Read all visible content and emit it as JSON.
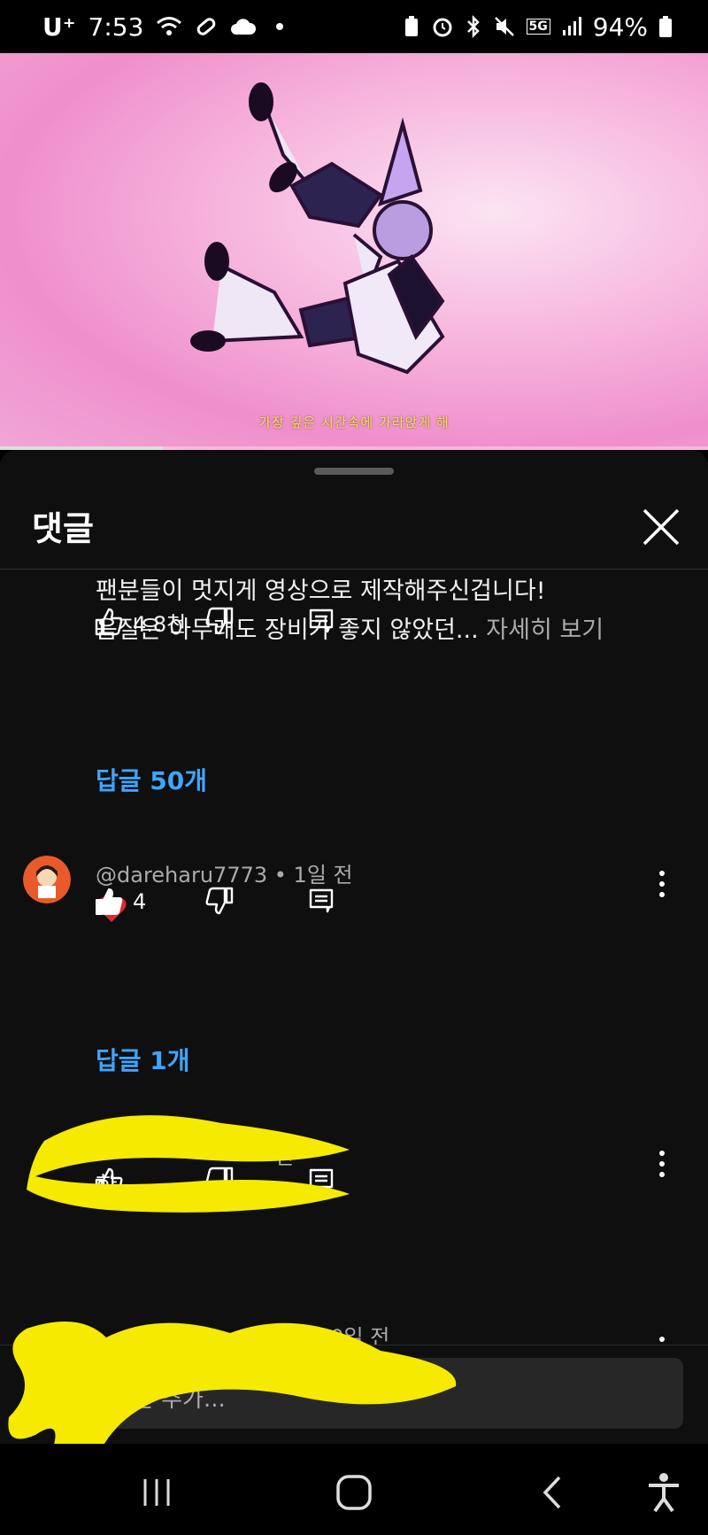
{
  "status_bar": {
    "carrier": "U⁺",
    "time": "7:53",
    "network": "5G",
    "battery": "94%"
  },
  "video": {
    "subtitle": "가장 깊은 시간속에 가라앉게 해",
    "progress_fraction": 0.23
  },
  "sheet": {
    "title": "댓글"
  },
  "comments": [
    {
      "text_line1": "팬분들이 멋지게 영상으로 제작해주신겁니다!",
      "text_line2": "음질은 아무래도 장비가 좋지 않았던...",
      "more_label": "자세히 보기",
      "like_count": "4.8천",
      "replies_label": "답글 50개"
    },
    {
      "author": "@dareharu7773",
      "time": "1일 전",
      "text": "❤️",
      "like_count": "4",
      "replies_label": "답글 1개"
    },
    {
      "time_partial": "전",
      "text_partial": "한"
    },
    {
      "time_partial": "10일 전"
    }
  ],
  "input": {
    "placeholder": "댓글 추가..."
  },
  "icons": {
    "like": "thumb-up-icon",
    "dislike": "thumb-down-icon",
    "reply": "reply-icon",
    "more": "more-vert-icon",
    "close": "close-icon"
  },
  "colors": {
    "link_blue": "#3ea6ff",
    "scribble_yellow": "#f5ea00",
    "heart_red": "#e0282e"
  }
}
